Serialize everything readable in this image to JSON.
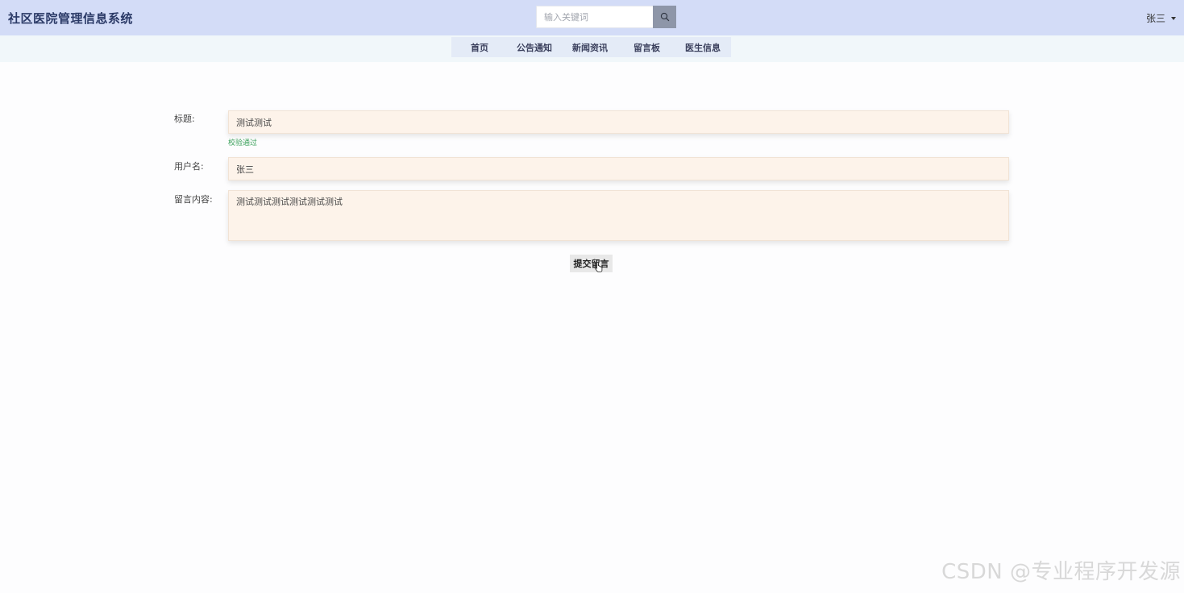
{
  "header": {
    "brand": "社区医院管理信息系统",
    "search_placeholder": "输入关键词",
    "search_icon": "search-icon",
    "user_name": "张三",
    "user_caret_icon": "caret-down-icon"
  },
  "nav": {
    "items": [
      "首页",
      "公告通知",
      "新闻资讯",
      "留言板",
      "医生信息"
    ]
  },
  "form": {
    "title_label": "标题:",
    "title_value": "测试测试",
    "title_validation": "校验通过",
    "username_label": "用户名:",
    "username_value": "张三",
    "content_label": "留言内容:",
    "content_value": "测试测试测试测试测试测试",
    "submit_label": "提交留言"
  },
  "watermark": "CSDN @专业程序开发源",
  "colors": {
    "topbar": "#d3dcf7",
    "navbar": "#f1f7fa",
    "field_bg": "#fdf3ea",
    "valid_text": "#3aa05a"
  }
}
